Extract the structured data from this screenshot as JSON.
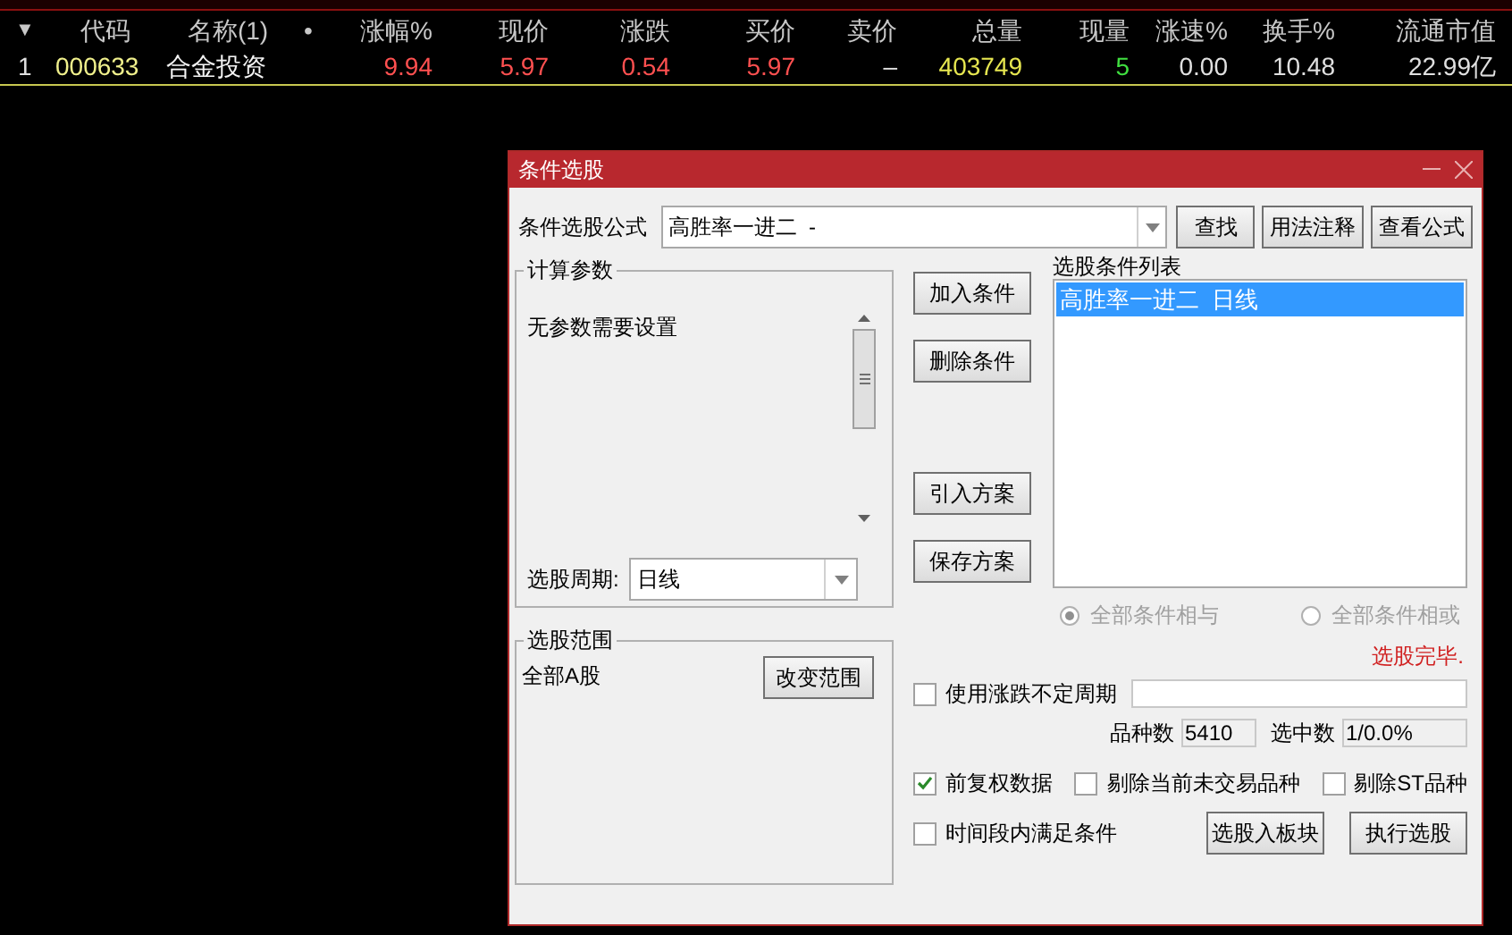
{
  "quote_table": {
    "columns": [
      {
        "label": "▼",
        "kind": "index"
      },
      {
        "label": "代码",
        "kind": "text"
      },
      {
        "label": "名称(1)",
        "kind": "text"
      },
      {
        "label": "•",
        "kind": "dot"
      },
      {
        "label": "涨幅%",
        "kind": "num"
      },
      {
        "label": "现价",
        "kind": "num"
      },
      {
        "label": "涨跌",
        "kind": "num"
      },
      {
        "label": "买价",
        "kind": "num"
      },
      {
        "label": "卖价",
        "kind": "num"
      },
      {
        "label": "总量",
        "kind": "num"
      },
      {
        "label": "现量",
        "kind": "num"
      },
      {
        "label": "涨速%",
        "kind": "num"
      },
      {
        "label": "换手%",
        "kind": "num"
      },
      {
        "label": "流通市值",
        "kind": "num"
      }
    ],
    "rows": [
      {
        "selected": true,
        "cells": [
          {
            "text": "1",
            "kind": "plain"
          },
          {
            "text": "000633",
            "kind": "code"
          },
          {
            "text": "合金投资",
            "kind": "name"
          },
          {
            "text": ""
          },
          {
            "text": "9.94",
            "kind": "up"
          },
          {
            "text": "5.97",
            "kind": "up"
          },
          {
            "text": "0.54",
            "kind": "up"
          },
          {
            "text": "5.97",
            "kind": "up"
          },
          {
            "text": "–",
            "kind": "plain"
          },
          {
            "text": "403749",
            "kind": "volume"
          },
          {
            "text": "5",
            "kind": "buy"
          },
          {
            "text": "0.00",
            "kind": "plain"
          },
          {
            "text": "10.48",
            "kind": "plain"
          },
          {
            "text": "22.99亿",
            "kind": "plain"
          }
        ]
      }
    ]
  },
  "dialog": {
    "title": "条件选股",
    "formula_label": "条件选股公式",
    "formula_value": "高胜率一进二  -",
    "top_buttons": [
      "查找",
      "用法注释",
      "查看公式"
    ],
    "params_group": {
      "title": "计算参数",
      "message": "无参数需要设置",
      "period_label": "选股周期:",
      "period_value": "日线"
    },
    "middle_buttons": [
      "加入条件",
      "删除条件",
      "引入方案",
      "保存方案"
    ],
    "conditions": {
      "title": "选股条件列表",
      "items": [
        {
          "label": "高胜率一进二  日线",
          "selected": true
        }
      ]
    },
    "logic": [
      {
        "label": "全部条件相与",
        "selected": true
      },
      {
        "label": "全部条件相或",
        "selected": false
      }
    ],
    "status": "选股完毕.",
    "range_group": {
      "title": "选股范围",
      "value": "全部A股",
      "button": "改变范围"
    },
    "variable_period": {
      "label": "使用涨跌不定周期",
      "checked": false
    },
    "counts": [
      {
        "label": "品种数",
        "value": "5410"
      },
      {
        "label": "选中数",
        "value": "1/0.0%"
      }
    ],
    "options": [
      {
        "label": "前复权数据",
        "checked": true
      },
      {
        "label": "剔除当前未交易品种",
        "checked": false
      },
      {
        "label": "剔除ST品种",
        "checked": false
      }
    ],
    "time_condition": {
      "label": "时间段内满足条件",
      "checked": false
    },
    "bottom_buttons": [
      "选股入板块",
      "执行选股"
    ]
  }
}
